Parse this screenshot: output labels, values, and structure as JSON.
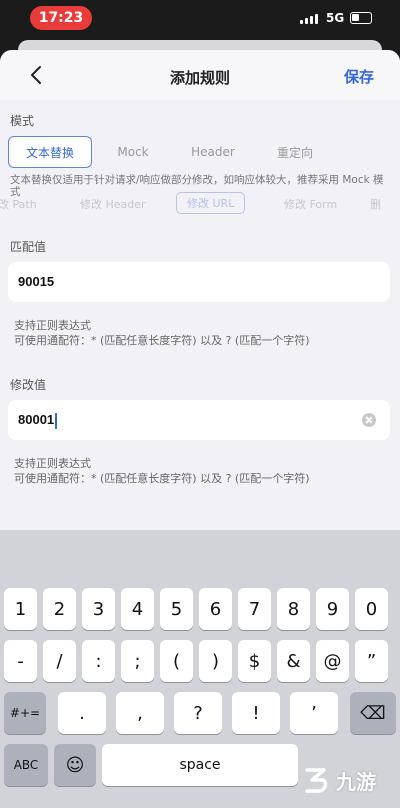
{
  "status": {
    "time": "17:23",
    "network": "5G"
  },
  "nav": {
    "title": "添加规则",
    "save_label": "保存"
  },
  "mode": {
    "label": "模式",
    "tabs": [
      {
        "label": "文本替换",
        "active": true
      },
      {
        "label": "Mock",
        "active": false
      },
      {
        "label": "Header",
        "active": false
      },
      {
        "label": "重定向",
        "active": false
      }
    ],
    "description": "文本替换仅适用于针对请求/响应做部分修改，如响应体较大，推荐采用 Mock 模式"
  },
  "background_tabs": [
    "改 Path",
    "修改 Header",
    "修改 URL",
    "修改 Form",
    "删"
  ],
  "match": {
    "label": "匹配值",
    "value": "90015",
    "hint_line1": "支持正则表达式",
    "hint_line2": "可使用通配符：* (匹配任意长度字符) 以及 ? (匹配一个字符)"
  },
  "modify": {
    "label": "修改值",
    "value": "80001",
    "hint_line1": "支持正则表达式",
    "hint_line2": "可使用通配符：* (匹配任意长度字符) 以及 ? (匹配一个字符)"
  },
  "keyboard": {
    "row1": [
      "1",
      "2",
      "3",
      "4",
      "5",
      "6",
      "7",
      "8",
      "9",
      "0"
    ],
    "row2": [
      "-",
      "/",
      ":",
      ";",
      "(",
      ")",
      "$",
      "&",
      "@",
      "”"
    ],
    "row3": [
      "#+=",
      ".",
      ",",
      "?",
      "!",
      "’",
      "⌫"
    ],
    "row4": {
      "abc": "ABC",
      "emoji": "☺",
      "space": "space"
    }
  },
  "watermark": {
    "text": "九游"
  }
}
